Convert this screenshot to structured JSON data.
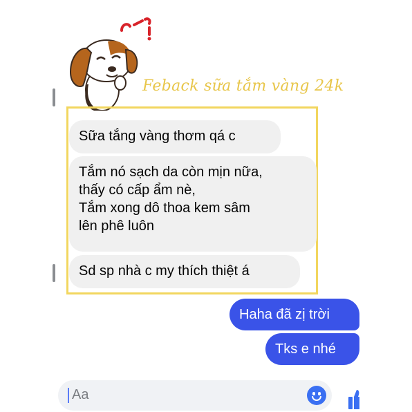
{
  "sticker": {
    "caption": "Feback sữa tắm vàng 24k",
    "icon": "puppy-sticker"
  },
  "incoming_messages": [
    "Sữa tắng vàng thơm qá c",
    "Tắm nó sạch da còn mịn nữa,\nthấy có cấp ẩm nè,\nTắm xong dô thoa kem sâm\nlên phê luôn",
    "Sd sp nhà c my thích thiệt á"
  ],
  "outgoing_messages": [
    "Haha đã zị trời",
    "Tks e nhé"
  ],
  "composer": {
    "placeholder": "Aa",
    "emoji_icon": "smiley-icon",
    "like_icon": "thumbs-up-icon"
  },
  "colors": {
    "incoming_bubble": "#f0f0f0",
    "outgoing_bubble": "#3a53e8",
    "frame": "#f2d65e",
    "caption": "#e8c64a"
  }
}
